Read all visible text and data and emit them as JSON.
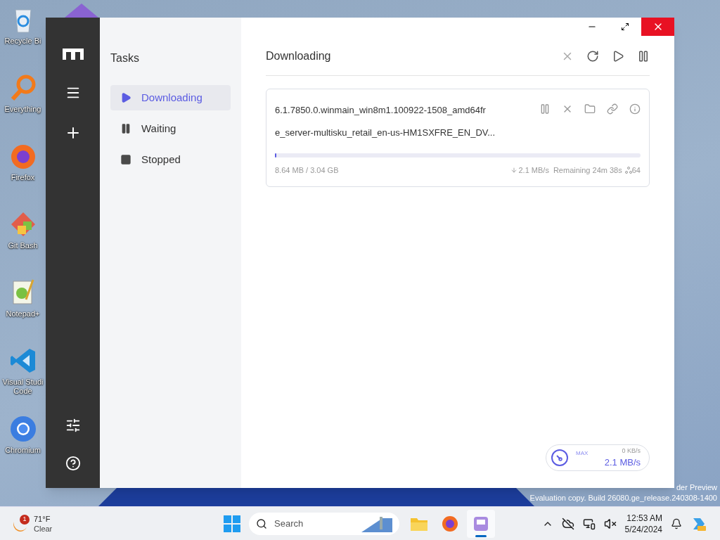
{
  "desktop": {
    "icons": [
      {
        "kind": "recycle",
        "label": "Recycle Bi"
      },
      {
        "kind": "everything",
        "label": "Everything"
      },
      {
        "kind": "firefox",
        "label": "Firefox"
      },
      {
        "kind": "gitbash",
        "label": "Git Bash"
      },
      {
        "kind": "notepad",
        "label": "Notepad+"
      },
      {
        "kind": "vscode",
        "label": "Visual Studi Code"
      },
      {
        "kind": "chromium",
        "label": "Chromium"
      }
    ],
    "watermark": [
      "der Preview",
      "Evaluation copy. Build 26080.ge_release.240308-1400"
    ]
  },
  "app": {
    "tasks_title": "Tasks",
    "lists": [
      {
        "kind": "play",
        "label": "Downloading",
        "selected": true
      },
      {
        "kind": "pause",
        "label": "Waiting",
        "selected": false
      },
      {
        "kind": "stop",
        "label": "Stopped",
        "selected": false
      }
    ],
    "title": "Downloading",
    "task": {
      "name_lines": [
        "6.1.7850.0.winmain_win8m1.100922-1508_amd64fr",
        "e_server-multisku_retail_en-us-HM1SXFRE_EN_DV..."
      ],
      "level": 0.003,
      "size": "8.64 MB / 3.04 GB",
      "speed": "2.1 MB/s",
      "remaining": "Remaining 24m 38s",
      "connections": "64"
    },
    "speed": {
      "label": "MAX",
      "upload": "0 KB/s",
      "download": "2.1 MB/s"
    }
  },
  "taskbar": {
    "weather": {
      "badge": "1",
      "temp": "71°F",
      "condition": "Clear"
    },
    "search": {
      "placeholder": "Search"
    },
    "apps": [
      {
        "kind": "files",
        "selected": false
      },
      {
        "kind": "firefox",
        "selected": false
      },
      {
        "kind": "motrix",
        "selected": true
      }
    ],
    "time": "12:53 AM",
    "date": "5/24/2024"
  }
}
